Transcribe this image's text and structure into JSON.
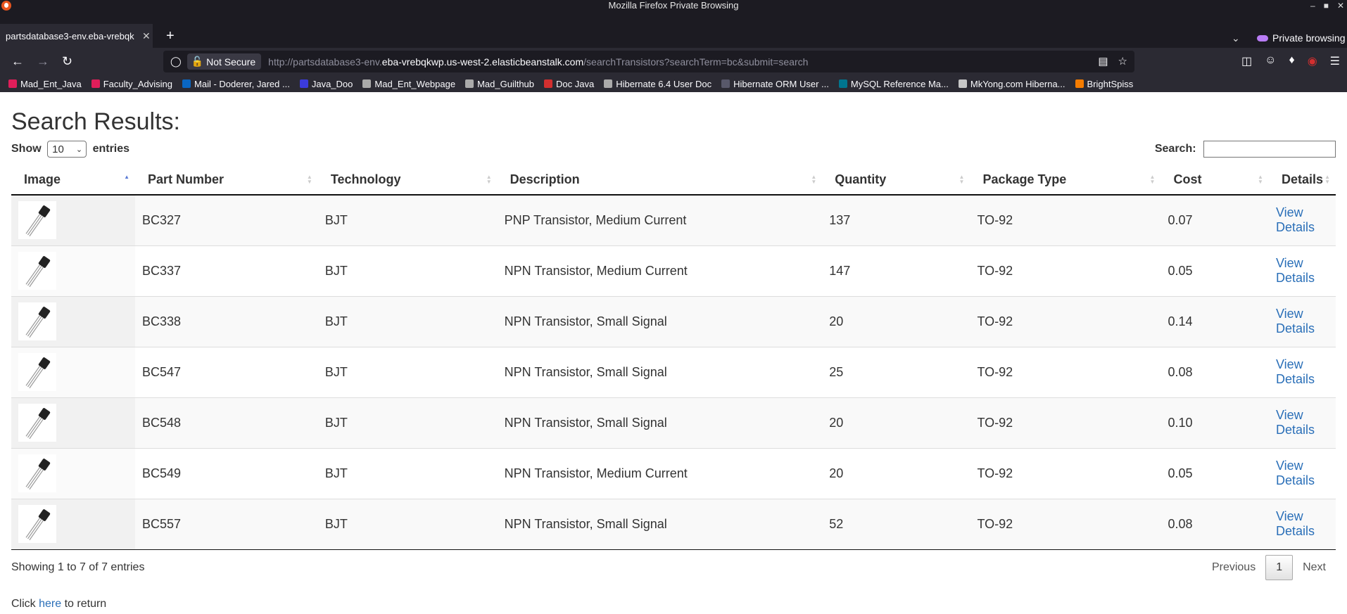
{
  "window": {
    "title": "Mozilla Firefox Private Browsing"
  },
  "browser": {
    "tab_title": "partsdatabase3-env.eba-vrebqk",
    "not_secure": "Not Secure",
    "url_prefix": "http://partsdatabase3-env.",
    "url_host": "eba-vrebqkwp.us-west-2.elasticbeanstalk.com",
    "url_path": "/searchTransistors?searchTerm=bc&submit=search",
    "private_browsing": "Private browsing"
  },
  "bookmarks": [
    {
      "label": "Mad_Ent_Java",
      "color": "#e01e5a"
    },
    {
      "label": "Faculty_Advising",
      "color": "#e01e5a"
    },
    {
      "label": "Mail - Doderer, Jared ...",
      "color": "#0a66c2"
    },
    {
      "label": "Java_Doo",
      "color": "#3b3bdc"
    },
    {
      "label": "Mad_Ent_Webpage",
      "color": "#aaaaaa"
    },
    {
      "label": "Mad_Guilthub",
      "color": "#aaaaaa"
    },
    {
      "label": "Doc Java",
      "color": "#d32f2f"
    },
    {
      "label": "Hibernate 6.4 User Doc",
      "color": "#aaaaaa"
    },
    {
      "label": "Hibernate ORM User ...",
      "color": "#58586a"
    },
    {
      "label": "MySQL Reference Ma...",
      "color": "#00758f"
    },
    {
      "label": "MkYong.com Hiberna...",
      "color": "#c7c7c7"
    },
    {
      "label": "BrightSpiss",
      "color": "#f57c00"
    }
  ],
  "page": {
    "title": "Search Results:",
    "show_label": "Show",
    "entries_label": "entries",
    "length_value": "10",
    "search_label": "Search:",
    "search_value": "",
    "columns": [
      "Image",
      "Part Number",
      "Technology",
      "Description",
      "Quantity",
      "Package Type",
      "Cost",
      "Details"
    ],
    "rows": [
      {
        "part": "BC327",
        "tech": "BJT",
        "desc": "PNP Transistor, Medium Current",
        "qty": "137",
        "pkg": "TO-92",
        "cost": "0.07",
        "details": "View Details"
      },
      {
        "part": "BC337",
        "tech": "BJT",
        "desc": "NPN Transistor, Medium Current",
        "qty": "147",
        "pkg": "TO-92",
        "cost": "0.05",
        "details": "View Details"
      },
      {
        "part": "BC338",
        "tech": "BJT",
        "desc": "NPN Transistor, Small Signal",
        "qty": "20",
        "pkg": "TO-92",
        "cost": "0.14",
        "details": "View Details"
      },
      {
        "part": "BC547",
        "tech": "BJT",
        "desc": "NPN Transistor, Small Signal",
        "qty": "25",
        "pkg": "TO-92",
        "cost": "0.08",
        "details": "View Details"
      },
      {
        "part": "BC548",
        "tech": "BJT",
        "desc": "NPN Transistor, Small Signal",
        "qty": "20",
        "pkg": "TO-92",
        "cost": "0.10",
        "details": "View Details"
      },
      {
        "part": "BC549",
        "tech": "BJT",
        "desc": "NPN Transistor, Medium Current",
        "qty": "20",
        "pkg": "TO-92",
        "cost": "0.05",
        "details": "View Details"
      },
      {
        "part": "BC557",
        "tech": "BJT",
        "desc": "NPN Transistor, Small Signal",
        "qty": "52",
        "pkg": "TO-92",
        "cost": "0.08",
        "details": "View Details"
      }
    ],
    "info": "Showing 1 to 7 of 7 entries",
    "prev": "Previous",
    "current_page": "1",
    "next": "Next",
    "return_prefix": "Click",
    "return_link": "here",
    "return_suffix": "to return"
  }
}
